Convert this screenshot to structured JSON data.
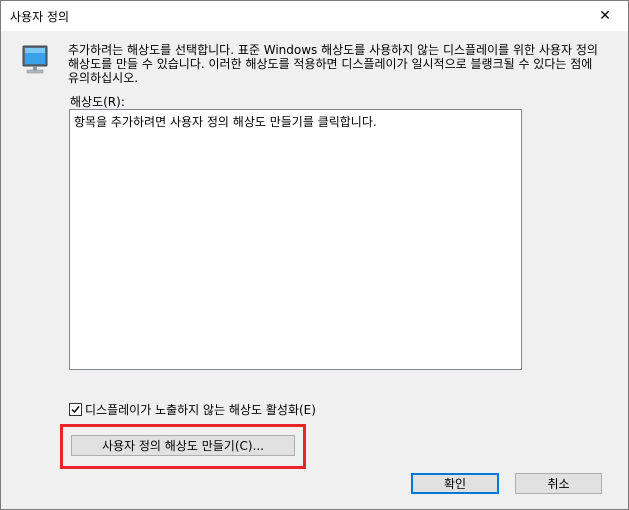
{
  "window": {
    "title": "사용자 정의",
    "close_glyph": "✕"
  },
  "description": "추가하려는 해상도를 선택합니다. 표준 Windows 해상도를 사용하지 않는 디스플레이를 위한 사용자 정의 해상도를 만들 수 있습니다. 이러한 해상도를 적용하면 디스플레이가 일시적으로 블랭크될 수 있다는 점에 유의하십시오.",
  "resolution_label": "해상도(R):",
  "resolution_list": {
    "placeholder": "항목을 추가하려면 사용자 정의 해상도 만들기를 클릭합니다."
  },
  "checkbox": {
    "label": "디스플레이가 노출하지 않는 해상도 활성화(E)",
    "checked": true
  },
  "buttons": {
    "create_label": "사용자 정의 해상도 만들기(C)...",
    "ok_label": "확인",
    "cancel_label": "취소"
  },
  "colors": {
    "highlight": "#e8242a",
    "default_button_border": "#0078d7"
  }
}
